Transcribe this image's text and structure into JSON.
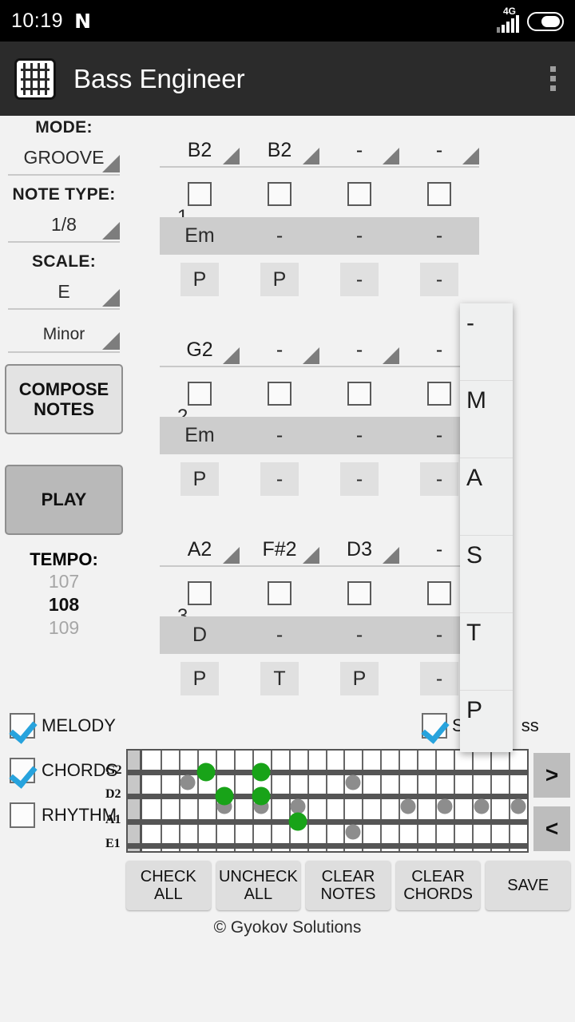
{
  "status_bar": {
    "time": "10:19",
    "carrier_icon": "nfc-n-icon",
    "network_label": "4G",
    "signal_icon": "signal-bars-icon",
    "battery_icon": "battery-icon"
  },
  "app_bar": {
    "title": "Bass Engineer",
    "icon": "fretboard-app-icon",
    "overflow_icon": "overflow-menu-icon"
  },
  "left_panel": {
    "mode_label": "MODE:",
    "mode_value": "GROOVE",
    "note_type_label": "NOTE TYPE:",
    "note_type_value": "1/8",
    "scale_label": "SCALE:",
    "scale_root_value": "E",
    "scale_quality_value": "Minor",
    "compose_notes_label": "COMPOSE NOTES",
    "play_label": "PLAY",
    "tempo_label": "TEMPO:",
    "tempo_prev": "107",
    "tempo_current": "108",
    "tempo_next": "109"
  },
  "grid": {
    "bars": [
      {
        "number": "1",
        "cells": [
          {
            "note": "B2",
            "checked": false,
            "chord": "Em",
            "technique": "P"
          },
          {
            "note": "B2",
            "checked": false,
            "chord": "-",
            "technique": "P"
          },
          {
            "note": "-",
            "checked": false,
            "chord": "-",
            "technique": "-"
          },
          {
            "note": "-",
            "checked": false,
            "chord": "-",
            "technique": "-"
          }
        ]
      },
      {
        "number": "2",
        "cells": [
          {
            "note": "G2",
            "checked": false,
            "chord": "Em",
            "technique": "P"
          },
          {
            "note": "-",
            "checked": false,
            "chord": "-",
            "technique": "-"
          },
          {
            "note": "-",
            "checked": false,
            "chord": "-",
            "technique": "-"
          },
          {
            "note": "-",
            "checked": false,
            "chord": "-",
            "technique": "-"
          }
        ]
      },
      {
        "number": "3",
        "cells": [
          {
            "note": "A2",
            "checked": false,
            "chord": "D",
            "technique": "P"
          },
          {
            "note": "F#2",
            "checked": false,
            "chord": "-",
            "technique": "T"
          },
          {
            "note": "D3",
            "checked": false,
            "chord": "-",
            "technique": "P"
          },
          {
            "note": "-",
            "checked": false,
            "chord": "-",
            "technique": "-"
          }
        ]
      }
    ]
  },
  "dropdown": {
    "open": true,
    "items": [
      "-",
      "M",
      "A",
      "S",
      "T",
      "P"
    ]
  },
  "checkboxes": [
    {
      "label": "MELODY",
      "checked": true
    },
    {
      "label": "CHORDS",
      "checked": true
    },
    {
      "label": "RHYTHM",
      "checked": false
    }
  ],
  "right_checkbox": {
    "label_visible_start": "S",
    "label_visible_end": "ss",
    "checked": true
  },
  "fretboard": {
    "string_labels": [
      "G2",
      "D2",
      "A1",
      "E1"
    ],
    "fret_count": 21,
    "green_notes": [
      {
        "string": 0,
        "fret": 4
      },
      {
        "string": 0,
        "fret": 7
      },
      {
        "string": 1,
        "fret": 5
      },
      {
        "string": 1,
        "fret": 7
      },
      {
        "string": 2,
        "fret": 9
      }
    ],
    "marker_dots": [
      {
        "between": 0,
        "fret": 3
      },
      {
        "between": 1,
        "fret": 5
      },
      {
        "between": 1,
        "fret": 7
      },
      {
        "between": 1,
        "fret": 9
      },
      {
        "between": 1,
        "fret": 15
      },
      {
        "between": 1,
        "fret": 17
      },
      {
        "between": 1,
        "fret": 19
      },
      {
        "between": 1,
        "fret": 21
      },
      {
        "between": 0,
        "fret": 12
      },
      {
        "between": 2,
        "fret": 12
      }
    ],
    "colors": {
      "active": "#18a318",
      "marker": "#8d8d8d"
    }
  },
  "nav": {
    "next_label": ">",
    "prev_label": "<"
  },
  "bottom_buttons": [
    "CHECK ALL",
    "UNCHECK ALL",
    "CLEAR NOTES",
    "CLEAR CHORDS",
    "SAVE"
  ],
  "footer": {
    "copyright": "© Gyokov Solutions"
  },
  "colors": {
    "accent": "#27a3dd",
    "appbar": "#2b2b2b",
    "background": "#f2f2f2"
  }
}
